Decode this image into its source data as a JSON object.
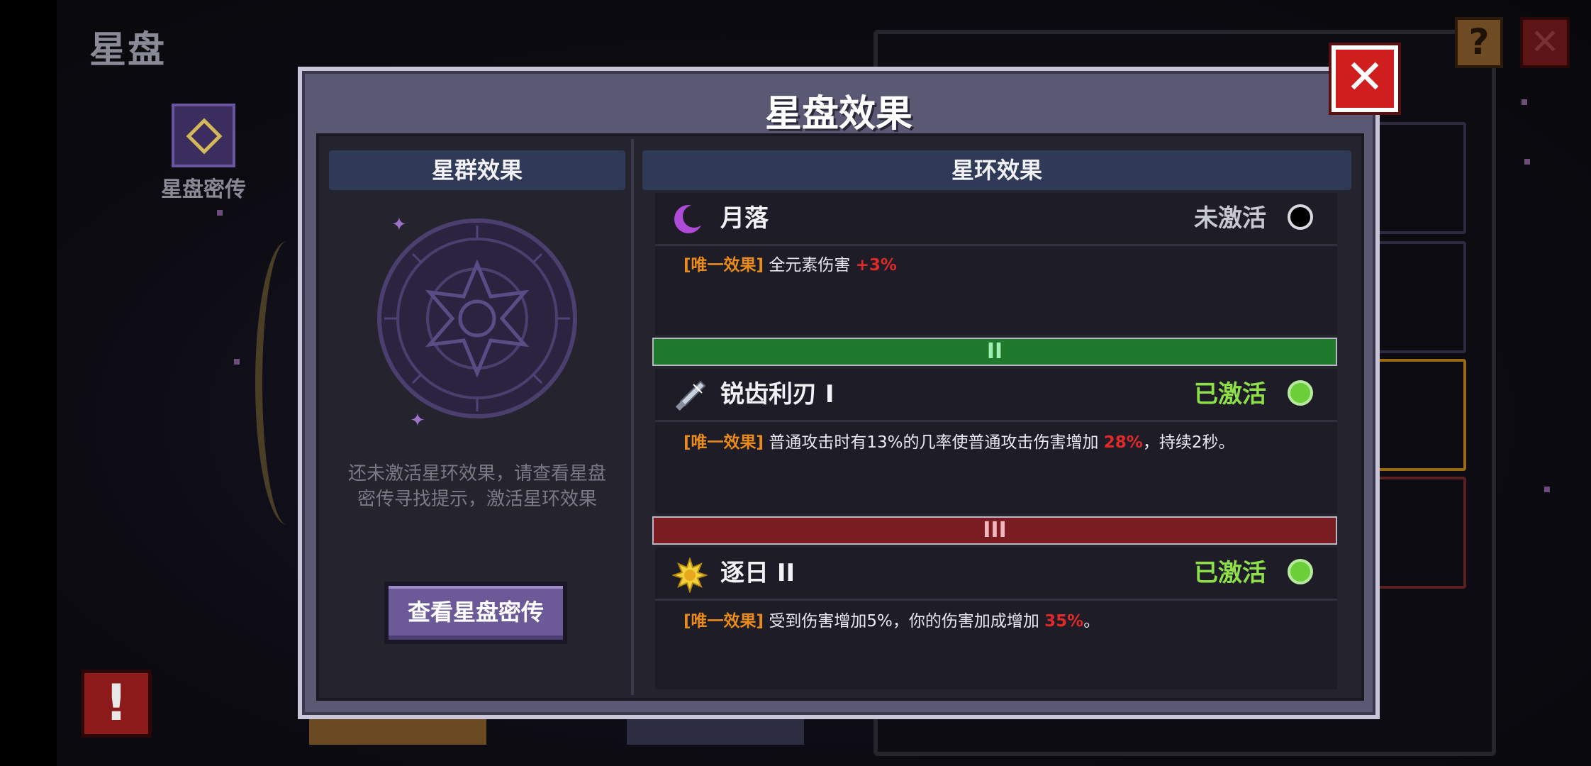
{
  "page": {
    "title": "星盘",
    "lore_label": "星盘密传"
  },
  "top_right": {
    "help_symbol": "?",
    "close_symbol": "✕"
  },
  "alert_symbol": "!",
  "dialog": {
    "title": "星盘效果",
    "close_symbol": "✕",
    "left": {
      "header": "星群效果",
      "hint_line1": "还未激活星环效果，请查看星盘",
      "hint_line2": "密传寻找提示，激活星环效果",
      "button": "查看星盘密传"
    },
    "right": {
      "header": "星环效果",
      "entries": [
        {
          "icon": "crescent-moon-icon",
          "name": "月落",
          "status": "未激活",
          "status_color": "#c8c8d0",
          "dot_color": "#000000",
          "tag": "[唯一效果]",
          "desc": " 全元素伤害 ",
          "num": "+3%",
          "desc_tail": ""
        },
        {
          "tier": "II",
          "tier_color": "#1f7a2e",
          "tier_text_color": "#9ff0b0",
          "icon": "blade-icon",
          "name": "锐齿利刃 I",
          "status": "已激活",
          "status_color": "#8ee04a",
          "dot_color": "#6ccf3a",
          "tag": "[唯一效果]",
          "desc": " 普通攻击时有13%的几率使普通攻击伤害增加 ",
          "num": "28%",
          "desc_tail": "，持续2秒。"
        },
        {
          "tier": "III",
          "tier_color": "#7a1c22",
          "tier_text_color": "#f0b8bc",
          "icon": "sun-icon",
          "name": "逐日 II",
          "status": "已激活",
          "status_color": "#8ee04a",
          "dot_color": "#6ccf3a",
          "tag": "[唯一效果]",
          "desc": " 受到伤害增加5%，你的伤害加成增加 ",
          "num": "35%",
          "desc_tail": "。"
        }
      ]
    }
  }
}
